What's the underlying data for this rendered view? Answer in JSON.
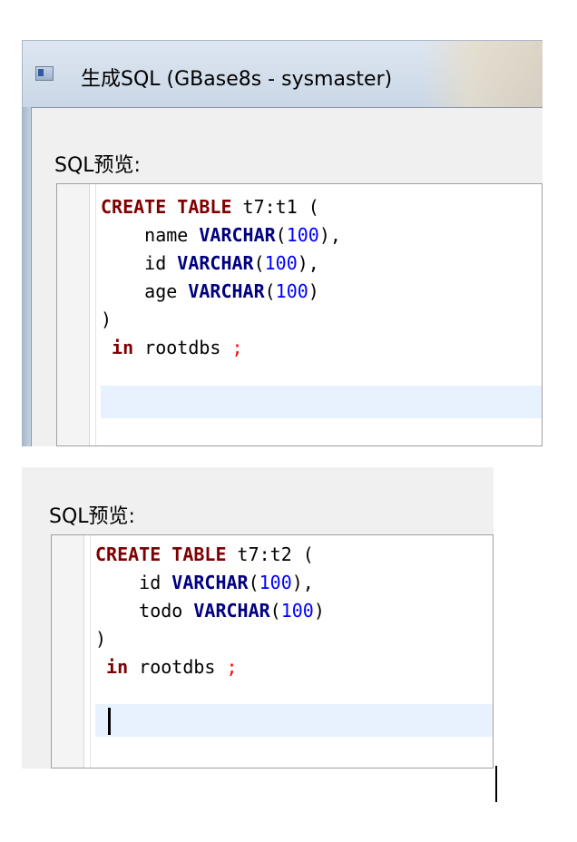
{
  "window": {
    "title": "生成SQL (GBase8s - sysmaster)",
    "icon": "app-window-icon"
  },
  "preview_top": {
    "label": "SQL预览:",
    "lines": [
      [
        {
          "t": "CREATE TABLE",
          "c": "kw"
        },
        {
          "t": " t7:t1 (",
          "c": ""
        }
      ],
      [
        {
          "t": "    name ",
          "c": ""
        },
        {
          "t": "VARCHAR",
          "c": "ty"
        },
        {
          "t": "(",
          "c": ""
        },
        {
          "t": "100",
          "c": "num"
        },
        {
          "t": "),",
          "c": ""
        }
      ],
      [
        {
          "t": "    id ",
          "c": ""
        },
        {
          "t": "VARCHAR",
          "c": "ty"
        },
        {
          "t": "(",
          "c": ""
        },
        {
          "t": "100",
          "c": "num"
        },
        {
          "t": "),",
          "c": ""
        }
      ],
      [
        {
          "t": "    age ",
          "c": ""
        },
        {
          "t": "VARCHAR",
          "c": "ty"
        },
        {
          "t": "(",
          "c": ""
        },
        {
          "t": "100",
          "c": "num"
        },
        {
          "t": ")",
          "c": ""
        }
      ],
      [
        {
          "t": ")",
          "c": ""
        }
      ],
      [
        {
          "t": " in",
          "c": "kw"
        },
        {
          "t": " rootdbs ",
          "c": ""
        },
        {
          "t": ";",
          "c": "semi"
        }
      ],
      []
    ]
  },
  "preview_bottom": {
    "label": "SQL预览:",
    "lines": [
      [
        {
          "t": "CREATE TABLE",
          "c": "kw"
        },
        {
          "t": " t7:t2 (",
          "c": ""
        }
      ],
      [
        {
          "t": "    id ",
          "c": ""
        },
        {
          "t": "VARCHAR",
          "c": "ty"
        },
        {
          "t": "(",
          "c": ""
        },
        {
          "t": "100",
          "c": "num"
        },
        {
          "t": "),",
          "c": ""
        }
      ],
      [
        {
          "t": "    todo ",
          "c": ""
        },
        {
          "t": "VARCHAR",
          "c": "ty"
        },
        {
          "t": "(",
          "c": ""
        },
        {
          "t": "100",
          "c": "num"
        },
        {
          "t": ")",
          "c": ""
        }
      ],
      [
        {
          "t": ")",
          "c": ""
        }
      ],
      [
        {
          "t": " in",
          "c": "kw"
        },
        {
          "t": " rootdbs ",
          "c": ""
        },
        {
          "t": ";",
          "c": "semi"
        }
      ],
      []
    ]
  },
  "colors": {
    "keyword": "#7f0000",
    "type": "#000080",
    "number": "#0000ff",
    "semicolon": "#ff0000",
    "current_line": "#e8f2fe"
  }
}
